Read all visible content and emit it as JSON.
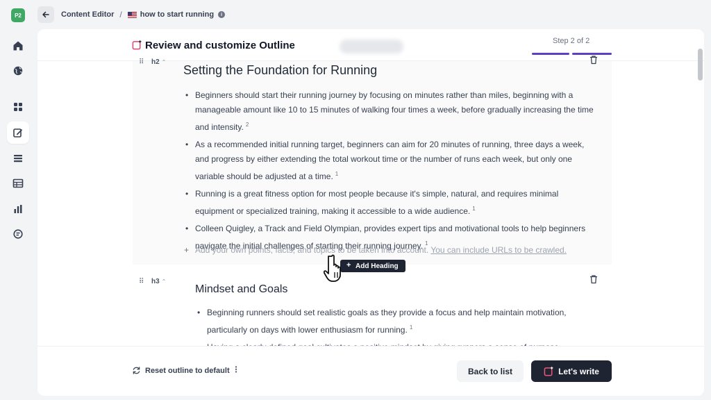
{
  "sidebar": {
    "logo": "P2",
    "items": [
      {
        "name": "home-icon"
      },
      {
        "name": "globe-icon"
      },
      {
        "name": "grid-icon"
      },
      {
        "name": "edit-icon"
      },
      {
        "name": "list-icon"
      },
      {
        "name": "table-icon"
      },
      {
        "name": "bar-chart-icon"
      },
      {
        "name": "document-icon"
      }
    ],
    "active_index": 3
  },
  "breadcrumb": {
    "section": "Content Editor",
    "separator": "/",
    "document": "how to start running",
    "info": "i"
  },
  "header": {
    "title": "Review and customize Outline",
    "step": "Step 2 of 2"
  },
  "outline": {
    "section": {
      "level": "h2",
      "heading": "Setting the Foundation for Running",
      "points": [
        {
          "text": "Beginners should start their running journey by focusing on minutes rather than miles, beginning with a manageable amount like 10 to 15 minutes of walking four times a week, before gradually increasing the time and intensity.",
          "ref": "2"
        },
        {
          "text": "As a recommended initial running target, beginners can aim for 20 minutes of running, three days a week, and progress by either extending the total workout time or the number of runs each week, but only one variable should be adjusted at a time.",
          "ref": "1"
        },
        {
          "text": "Running is a great fitness option for most people because it's simple, natural, and requires minimal equipment or specialized training, making it accessible to a wide audience.",
          "ref": "1"
        },
        {
          "text": "Colleen Quigley, a Track and Field Olympian, provides expert tips and motivational tools to help beginners navigate the initial challenges of starting their running journey.",
          "ref": "1"
        }
      ],
      "add_plus": "+",
      "add_text": "Add your own points, facts, and topics to be taken into account.",
      "add_link": "You can include URLs to be crawled."
    },
    "add_heading_label": "Add Heading",
    "add_heading_plus": "+",
    "subsection": {
      "level": "h3",
      "heading": "Mindset and Goals",
      "points": [
        {
          "text": "Beginning runners should set realistic goals as they provide a focus and help maintain motivation, particularly on days with lower enthusiasm for running.",
          "ref": "1"
        },
        {
          "text": "Having a clearly defined goal cultivates a positive mindset by giving runners a sense of purpose",
          "ref": ""
        }
      ]
    }
  },
  "footer": {
    "reset_label": "Reset outline to default",
    "more": "⋮",
    "back_label": "Back to list",
    "write_label": "Let's write"
  },
  "colors": {
    "accent": "#5b3fc4",
    "dark_button": "#1f2433",
    "logo_green": "#3fa864",
    "write_icon": "#f0567a"
  }
}
